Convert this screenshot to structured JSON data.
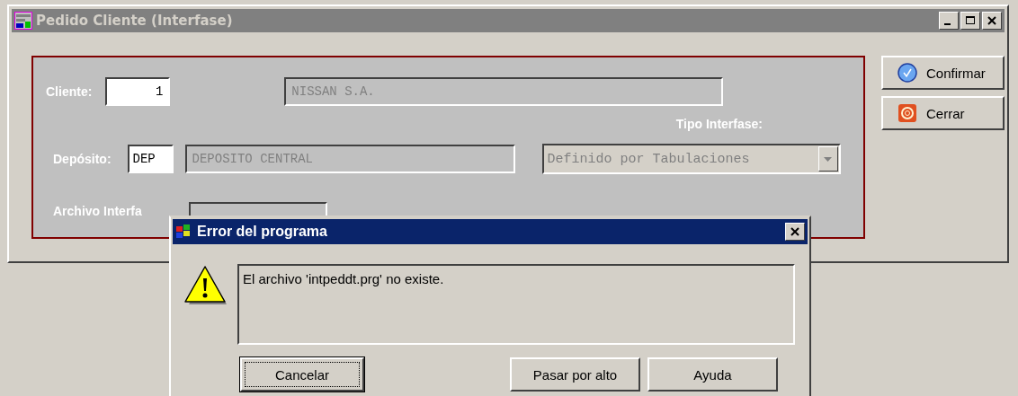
{
  "window": {
    "title": "Pedido Cliente (Interfase)",
    "active": false
  },
  "form": {
    "cliente": {
      "label": "Cliente:",
      "value": "1",
      "name": "NISSAN S.A."
    },
    "tipo_interfase": {
      "label": "Tipo Interfase:",
      "value": "Definido por Tabulaciones",
      "disabled": true
    },
    "deposito": {
      "label": "Depósito:",
      "value": "DEP",
      "name": "DEPOSITO CENTRAL"
    },
    "archivo": {
      "label": "Archivo Interfa"
    }
  },
  "buttons": [
    {
      "label": "Confirmar",
      "kind": "confirm"
    },
    {
      "label": "Cerrar",
      "kind": "close"
    }
  ],
  "dialog": {
    "title": "Error del programa",
    "message": "El archivo 'intpeddt.prg' no existe.",
    "buttons": [
      {
        "label": "Cancelar",
        "focused": true
      },
      {
        "label": "Pasar por alto",
        "focused": false
      },
      {
        "label": "Ayuda",
        "focused": false
      }
    ]
  }
}
